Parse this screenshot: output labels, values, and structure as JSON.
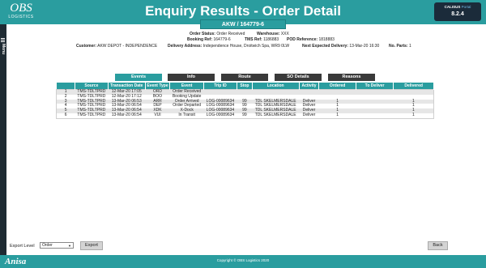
{
  "header": {
    "logo_main": "OBS",
    "logo_sub": "LOGISTICS",
    "title": "Enquiry Results - Order Detail",
    "version_brand_1": "CALISUS",
    "version_brand_2": "Portal",
    "version": "8.2.4"
  },
  "rail": {
    "menu_text": "Menu"
  },
  "order": {
    "badge": "AKW / 164779-6",
    "status_label": "Order Status:",
    "status": "Order Received",
    "warehouse_label": "Warehouse:",
    "warehouse": "XXX",
    "booking_label": "Booking Ref:",
    "booking": "164779-6",
    "tms_label": "TMS Ref:",
    "tms": "1186883",
    "pod_label": "POD Reference:",
    "pod": "1818883",
    "customer_label": "Customer:",
    "customer": "AKW DEPOT - INDEPENDENCE",
    "delivery_label": "Delivery Address:",
    "delivery": "Independence House, Droitwich Spa, WR9 0LW",
    "next_label": "Next Expected Delivery:",
    "next": "13-Mar-20 16:30",
    "parts_label": "No. Parts:",
    "parts": "1"
  },
  "tabs": [
    "Events",
    "Info",
    "Route",
    "SO Details",
    "Reasons"
  ],
  "table": {
    "headers": [
      "",
      "Source",
      "Transaction Date",
      "Event Type",
      "Event",
      "Trip ID",
      "Stop",
      "Location",
      "Activity",
      "Ordered",
      "To Deliver",
      "Delivered"
    ],
    "rows": [
      [
        "1",
        "TMS-TDLTPRD",
        "12-Mar-20 17:05",
        "ORD",
        "Order Received",
        "",
        "",
        "",
        "",
        "",
        "",
        ""
      ],
      [
        "2",
        "TMS-TDLTPRD",
        "12-Mar-20 17:12",
        "BOO",
        "Booking Update",
        "",
        "",
        "",
        "",
        "",
        "",
        ""
      ],
      [
        "3",
        "TMS-TDLTPRD",
        "13-Mar-20 06:53",
        "ARR",
        "Order Arrived",
        "LOG-00089634",
        "99",
        "TDL SKELMERSDALE",
        "Deliver",
        "1",
        "",
        "1"
      ],
      [
        "4",
        "TMS-TDLTPRD",
        "13-Mar-20 06:54",
        "DEP",
        "Order Departed",
        "LOG-00089634",
        "99",
        "TDL SKELMERSDALE",
        "Deliver",
        "1",
        "",
        "1"
      ],
      [
        "5",
        "TMS-TDLTPRD",
        "13-Mar-20 06:54",
        "XDK",
        "X-Dock",
        "LOG-00089634",
        "99",
        "TDL SKELMERSDALE",
        "Deliver",
        "1",
        "",
        "1"
      ],
      [
        "6",
        "TMS-TDLTPRD",
        "13-Mar-20 06:54",
        "VUI",
        "In Transit",
        "LOG-00089634",
        "99",
        "TDL SKELMERSDALE",
        "Deliver",
        "1",
        "",
        "1"
      ]
    ]
  },
  "footer_controls": {
    "export_label": "Export Level",
    "export_value": "Order",
    "export_button": "Export",
    "back_button": "Back"
  },
  "footer": {
    "logo": "Anisa",
    "copyright": "Copyright © OBS Logistics 2020"
  },
  "colors": {
    "accent": "#2a9d9f",
    "dark": "#3a3a3a"
  }
}
